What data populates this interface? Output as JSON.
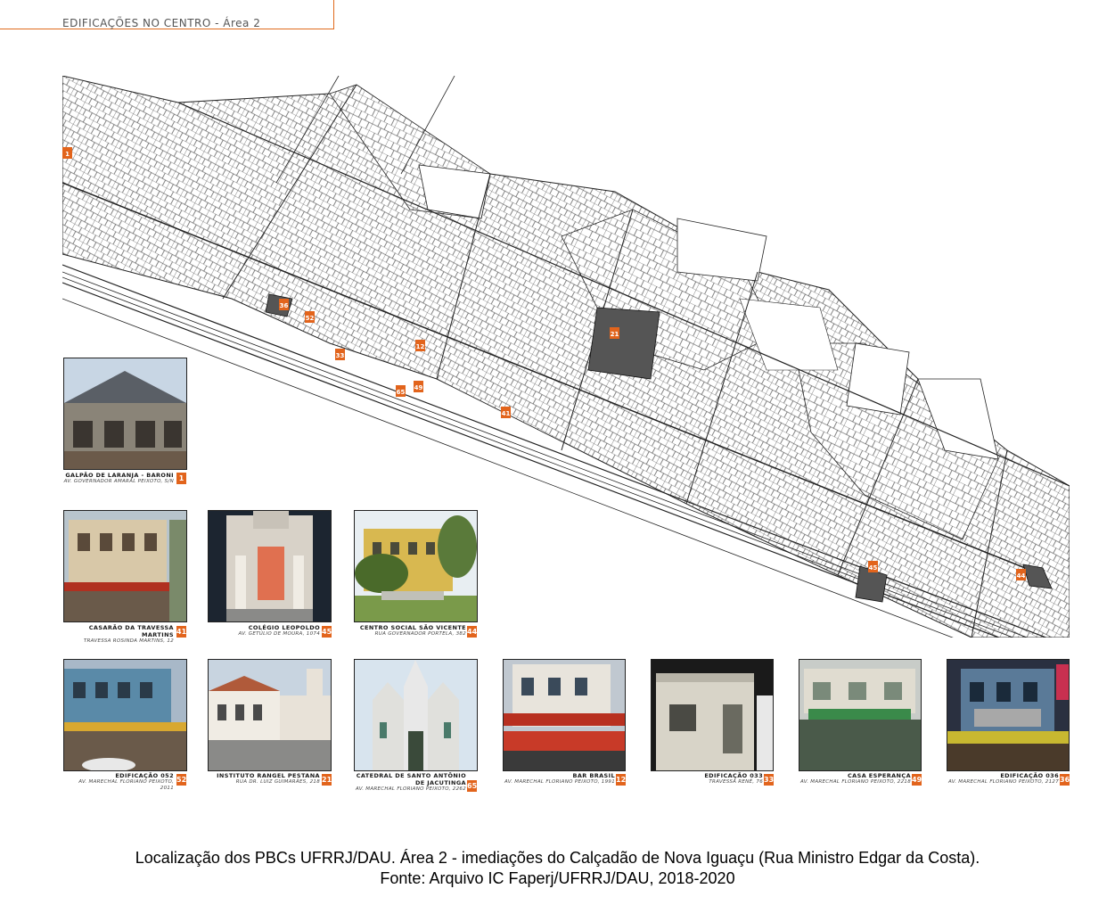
{
  "header": {
    "title": "EDIFICAÇÕES NO CENTRO - Área 2"
  },
  "map": {
    "markers": [
      {
        "num": "1"
      },
      {
        "num": "36"
      },
      {
        "num": "52"
      },
      {
        "num": "21"
      },
      {
        "num": "33"
      },
      {
        "num": "12"
      },
      {
        "num": "49"
      },
      {
        "num": "65"
      },
      {
        "num": "41"
      },
      {
        "num": "45"
      },
      {
        "num": "44"
      }
    ]
  },
  "buildings": [
    {
      "title": "GALPÃO DE LARANJA - BARONI",
      "title2": "",
      "address": "AV. GOVERNADOR AMARAL PEIXOTO, S/N",
      "num": "1"
    },
    {
      "title": "CASARÃO DA TRAVESSA MARTINS",
      "title2": "",
      "address": "TRAVESSA ROSINDA MARTINS, 12",
      "num": "41"
    },
    {
      "title": "COLÉGIO LEOPOLDO",
      "title2": "",
      "address": "AV. GETÚLIO DE MOURA, 1074",
      "num": "45"
    },
    {
      "title": "CENTRO SOCIAL SÃO VICENTE",
      "title2": "",
      "address": "RUA GOVERNADOR PORTELA, 382",
      "num": "44"
    },
    {
      "title": "EDIFICAÇÃO 052",
      "title2": "",
      "address": "AV. MARECHAL FLORIANO PEIXOTO, 2011",
      "num": "52"
    },
    {
      "title": "INSTITUTO RANGEL PESTANA",
      "title2": "",
      "address": "RUA DR. LUIZ GUIMARÃES, 218",
      "num": "21"
    },
    {
      "title": "CATEDRAL DE SANTO ANTÔNIO",
      "title2": "DE JACUTINGA",
      "address": "AV. MARECHAL FLORIANO PEIXOTO, 2262",
      "num": "65"
    },
    {
      "title": "BAR BRASIL",
      "title2": "",
      "address": "AV. MARECHAL FLORIANO PEIXOTO, 1991",
      "num": "12"
    },
    {
      "title": "EDIFICAÇÃO 033",
      "title2": "",
      "address": "TRAVESSA RENÉ, 76",
      "num": "33"
    },
    {
      "title": "CASA ESPERANÇA",
      "title2": "",
      "address": "AV. MARECHAL FLORIANO PEIXOTO, 2218",
      "num": "49"
    },
    {
      "title": "EDIFICAÇÃO 036",
      "title2": "",
      "address": "AV. MARECHAL FLORIANO PEIXOTO, 2127",
      "num": "36"
    }
  ],
  "footer": {
    "line1": "Localização dos PBCs UFRRJ/DAU. Área 2 - imediações do Calçadão de Nova Iguaçu (Rua Ministro Edgar da Costa).",
    "line2": "Fonte: Arquivo IC Faperj/UFRRJ/DAU, 2018-2020"
  },
  "colors": {
    "accent": "#e2641c",
    "highlight_block": "#555555"
  }
}
